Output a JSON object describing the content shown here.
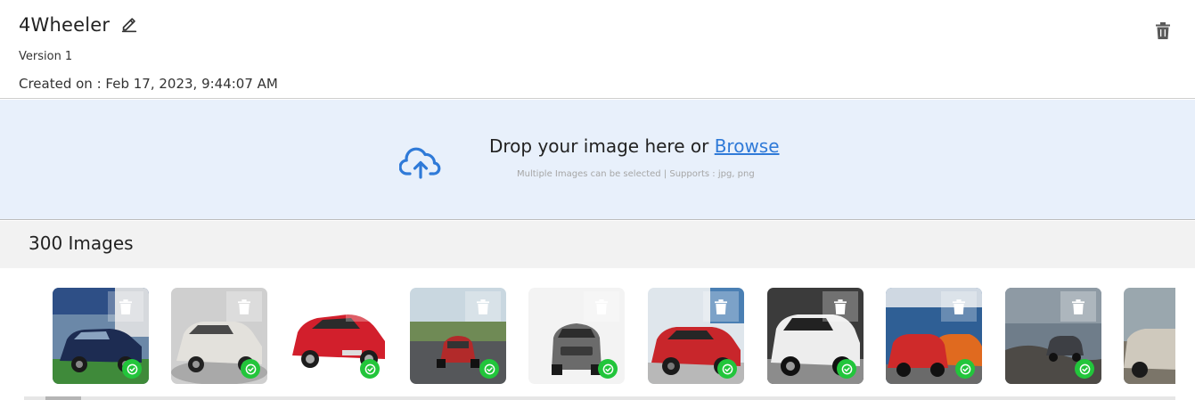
{
  "dataset": {
    "title": "4Wheeler",
    "version": "Version 1",
    "created": "Created on : Feb 17, 2023, 9:44:07 AM"
  },
  "icons": {
    "edit": "pencil-icon",
    "delete": "trash-icon",
    "upload": "cloud-upload-icon",
    "status": "check-circle-icon"
  },
  "upload": {
    "prompt": "Drop your image here or ",
    "browse": "Browse",
    "hint": "Multiple Images can be selected | Supports : jpg, png"
  },
  "images": {
    "count_label": "300 Images"
  },
  "colors": {
    "accent": "#2f7ad8",
    "dropzone_bg": "#e8f0fb",
    "success": "#22c53b"
  }
}
